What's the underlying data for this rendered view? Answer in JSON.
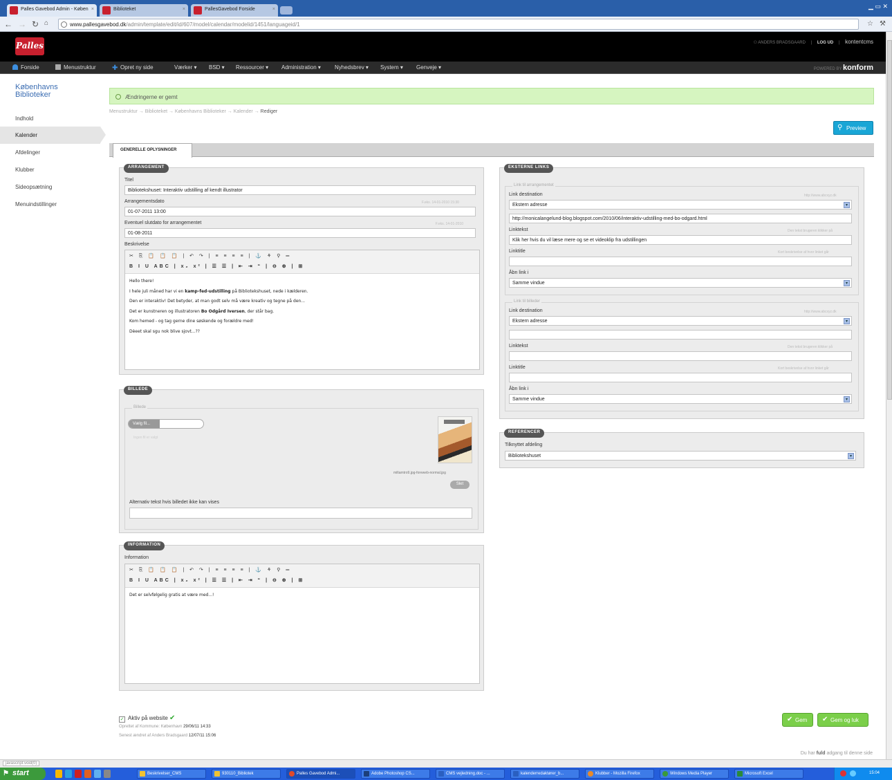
{
  "browser": {
    "tabs": [
      {
        "label": "Palles Gavebod Admin - Køben"
      },
      {
        "label": "Biblioteket"
      },
      {
        "label": "PallesGavebod Forside"
      }
    ],
    "url_host": "www.pallesgavebod.dk",
    "url_path": "/admin/template/edit/id/607/model/calendar/modelid/1451/languageid/1"
  },
  "header": {
    "logo": "Palles",
    "user": "ANDERS BRADSGAARD",
    "logout": "LOG UD",
    "brand": "kontentcms"
  },
  "menu": {
    "items": [
      "Forside",
      "Menustruktur",
      "Opret ny side",
      "Værker ▾",
      "BSD ▾",
      "Ressourcer ▾",
      "Administration ▾",
      "Nyhedsbrev ▾",
      "System ▾",
      "Genveje ▾"
    ],
    "powered_label": "POWERED BY",
    "powered_brand": "konform"
  },
  "sidebar": {
    "site_name": "Københavns Biblioteker",
    "items": [
      "Indhold",
      "Kalender",
      "Afdelinger",
      "Klubber",
      "Sideopsætning",
      "Menuindstillinger"
    ]
  },
  "notice": "Ændringerne er gemt",
  "breadcrumb": {
    "trail": "Menustruktur → Biblioteket → Københavns Biblioteker → Kalender →",
    "current": "Rediger"
  },
  "preview_label": "Preview",
  "tab_label": "GENERELLE OPLYSNINGER",
  "arrangement": {
    "title": "ARRANGEMENT",
    "titel_label": "Titel",
    "titel_value": "Bibliotekshuset: Interaktiv udstilling af kendt illustrator",
    "dato_label": "Arrangementsdato",
    "dato_hint": "F.eks. 14-01-2010 15:30",
    "dato_value": "01-07-2011 13:00",
    "slut_label": "Eventuel slutdato for arrangementet",
    "slut_hint": "F.eks. 14-01-2010",
    "slut_value": "01-08-2011",
    "beskrivelse_label": "Beskrivelse",
    "toolbar_row1": "✂ ⎘ 📋 📋 📋 | ↶ ↷ | ≡ ≡ ≡ ≡ | ⚓ ⚘ ⚲ ═",
    "toolbar_row2": "B I U ABC | x₂ x² | ☰ ☰ | ⇤ ⇥ “ | ⊖ ⊕ | ⊞",
    "lines": [
      "Hello there!",
      [
        "I hele juli måned har vi en ",
        "kamp-fed-udstilling",
        " på Bibliotekshuset, nede i kælderen."
      ],
      "Den er interaktiv! Det betyder, at man godt selv må være kreativ og tegne på den...",
      [
        "Det er kunstneren og illustratoren ",
        "Bo Odgård Iversen",
        ", der står bag."
      ],
      "Kom hemed - og tag gerne dine søskende og forældre med!",
      "Dèeet skal sgu nok blive sjovt...??"
    ]
  },
  "billede": {
    "title": "BILLEDE",
    "legend": "Billede",
    "choose": "Vælg fil...",
    "nofile": "Ingen fil er valgt",
    "filename": "miltamtro9.jpg-foreweb-normal.jpg",
    "delete": "Slet",
    "alt_label": "Alternativ tekst hvis billedet ikke kan vises",
    "alt_value": ""
  },
  "information": {
    "title": "INFORMATION",
    "label": "Information",
    "text": "Det er selvfølgelig gratis at være med...!"
  },
  "eksterne": {
    "title": "EKSTERNE LINKS",
    "legend1": "Link til arrangementet",
    "legend2": "Link til billeder",
    "dest_label": "Link destination",
    "dest_hint": "http://www.abcxyz.dk",
    "dest_value": "Ekstern adresse",
    "url_value": "http://monicalangelund-blog.blogspot.com/2010/06/interaktiv-udstilling-med-bo-odgard.html",
    "linktekst_label": "Linktekst",
    "linktekst_hint": "Den tekst brugeren klikker på",
    "linktekst_value": "Klik her hvis du vil læse mere og se et videoklip fra udstillingen",
    "linktitle_label": "Linktitle",
    "linktitle_hint": "Kort beskrivelse af hvor linket går",
    "abn_label": "Åbn link i",
    "abn_value": "Samme vindue",
    "dest2_value": "Ekstern adresse",
    "abn2_value": "Samme vindue"
  },
  "referencer": {
    "title": "REFERENCER",
    "label": "Tilknyttet afdeling",
    "value": "Bibliotekshuset"
  },
  "footer": {
    "aktiv": "Aktiv på website",
    "created": "Oprettet af Kommune: København",
    "created_at": "29/06/11 14:33",
    "changed": "Senest ændret af Anders Bradsgaard",
    "changed_at": "12/07/11 15:06",
    "gem": "Gem",
    "gem_luk": "Gem og luk",
    "access_prefix": "Du har",
    "access_bold": "fuld",
    "access_suffix": "adgang til denne side"
  },
  "statusbar": "javascript:void(0)",
  "taskbar": {
    "start": "start",
    "tasks": [
      "Beskrivelser_CMS",
      "930110_Bibliotek",
      "Palles Gavebod Admi...",
      "Adobe Photoshop CS...",
      "CMS vejledning.doc - ...",
      "kalenderredaktører_b...",
      "Klubber - Mozilla Firefox",
      "Windows Media Player",
      "Microsoft Excel"
    ],
    "clock": "15:04"
  }
}
